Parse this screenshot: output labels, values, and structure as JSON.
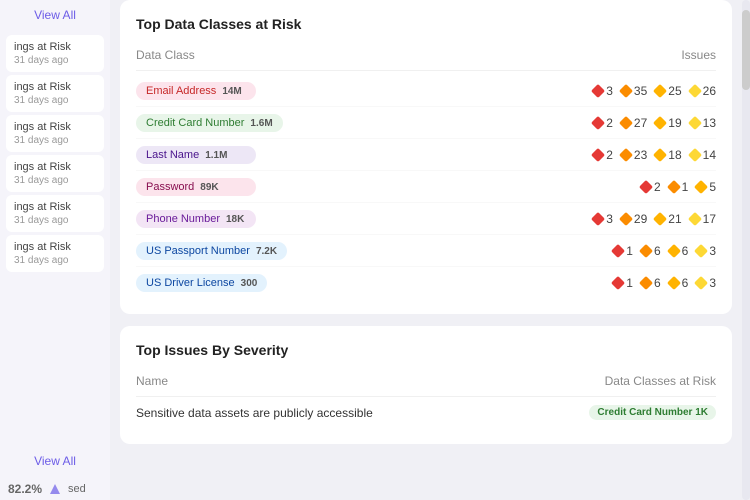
{
  "sidebar": {
    "view_all_top": "View All",
    "view_all_bottom": "View All",
    "items": [
      {
        "label": "ings at Risk",
        "date": "31 days ago"
      },
      {
        "label": "ings at Risk",
        "date": "31 days ago"
      },
      {
        "label": "ings at Risk",
        "date": "31 days ago"
      },
      {
        "label": "ings at Risk",
        "date": "31 days ago"
      },
      {
        "label": "ings at Risk",
        "date": "31 days ago"
      },
      {
        "label": "ings at Risk",
        "date": "31 days ago"
      }
    ],
    "bottom_label": "sed",
    "bottom_pct": "82.2%"
  },
  "top_data_classes": {
    "title": "Top Data Classes at Risk",
    "col_class": "Data Class",
    "col_issues": "Issues",
    "rows": [
      {
        "name": "Email Address",
        "count": "14M",
        "badge": "pink",
        "issues": [
          3,
          35,
          25,
          26
        ]
      },
      {
        "name": "Credit Card Number",
        "count": "1.6M",
        "badge": "green",
        "issues": [
          2,
          27,
          19,
          13
        ]
      },
      {
        "name": "Last Name",
        "count": "1.1M",
        "badge": "lavender",
        "issues": [
          2,
          23,
          18,
          14
        ]
      },
      {
        "name": "Password",
        "count": "89K",
        "badge": "light-pink",
        "issues": [
          2,
          1,
          5,
          null
        ]
      },
      {
        "name": "Phone Number",
        "count": "18K",
        "badge": "light-purple",
        "issues": [
          3,
          29,
          21,
          17
        ]
      },
      {
        "name": "US Passport Number",
        "count": "7.2K",
        "badge": "light-blue",
        "issues": [
          1,
          6,
          6,
          3
        ]
      },
      {
        "name": "US Driver License",
        "count": "300",
        "badge": "light-blue",
        "issues": [
          1,
          6,
          6,
          3
        ]
      }
    ]
  },
  "top_issues": {
    "title": "Top Issues By Severity",
    "col_name": "Name",
    "col_data_classes": "Data Classes at Risk",
    "rows": [
      {
        "name": "Sensitive data assets are publicly accessible",
        "tag": "Credit Card Number",
        "tag_count": "1K"
      }
    ]
  }
}
